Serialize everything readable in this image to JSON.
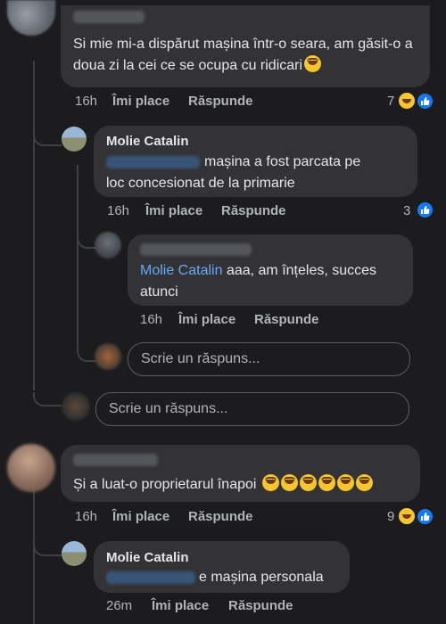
{
  "comments": [
    {
      "text": "Si mie mi-a dispărut mașina într-o seara, am găsit-o a doua zi la cei ce se ocupa cu ridicari",
      "time": "16h",
      "like_label": "Îmi place",
      "reply_label": "Răspunde",
      "reaction_count": "7",
      "reactions": [
        "haha-icon",
        "like-icon"
      ],
      "replies": [
        {
          "author": "Molie Catalin",
          "text": "mașina a fost parcata pe loc concesionat de la primarie",
          "time": "16h",
          "like_label": "Îmi place",
          "reply_label": "Răspunde",
          "reaction_count": "3",
          "reactions": [
            "like-icon"
          ],
          "replies": [
            {
              "mention": "Molie Catalin",
              "text": "aaa, am înțeles, succes atunci",
              "time": "16h",
              "like_label": "Îmi place",
              "reply_label": "Răspunde"
            }
          ],
          "reply_placeholder": "Scrie un răspuns..."
        }
      ],
      "reply_placeholder": "Scrie un răspuns..."
    },
    {
      "text": "Și a luat-o proprietarul înapoi",
      "emoji_count": 6,
      "time": "16h",
      "like_label": "Îmi place",
      "reply_label": "Răspunde",
      "reaction_count": "9",
      "reactions": [
        "haha-icon",
        "like-icon"
      ],
      "replies": [
        {
          "author": "Molie Catalin",
          "text": "e mașina personala",
          "time": "26m",
          "like_label": "Îmi place",
          "reply_label": "Răspunde"
        }
      ]
    }
  ],
  "colors": {
    "background": "#1c1c1e",
    "bubble": "#333335",
    "mention": "#6aa6f8",
    "like_blue": "#1877f2",
    "haha_yellow": "#f7c531"
  }
}
